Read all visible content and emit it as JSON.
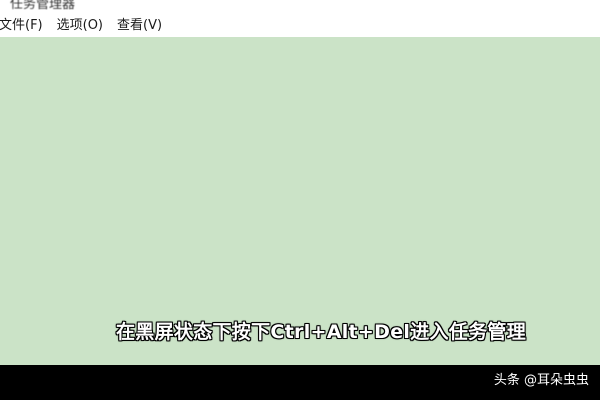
{
  "window": {
    "title": "任务管理器"
  },
  "menu": {
    "items": [
      {
        "label": "文件(F)"
      },
      {
        "label": "选项(O)"
      },
      {
        "label": "查看(V)"
      }
    ]
  },
  "video": {
    "subtitle": "在黑屏状态下按下Ctrl+Alt+Del进入任务管理",
    "watermark": "头条 @耳朵虫虫"
  },
  "colors": {
    "content_background": "#cbe3c7",
    "bar_background": "#000000",
    "subtitle_text": "#ffffff"
  }
}
